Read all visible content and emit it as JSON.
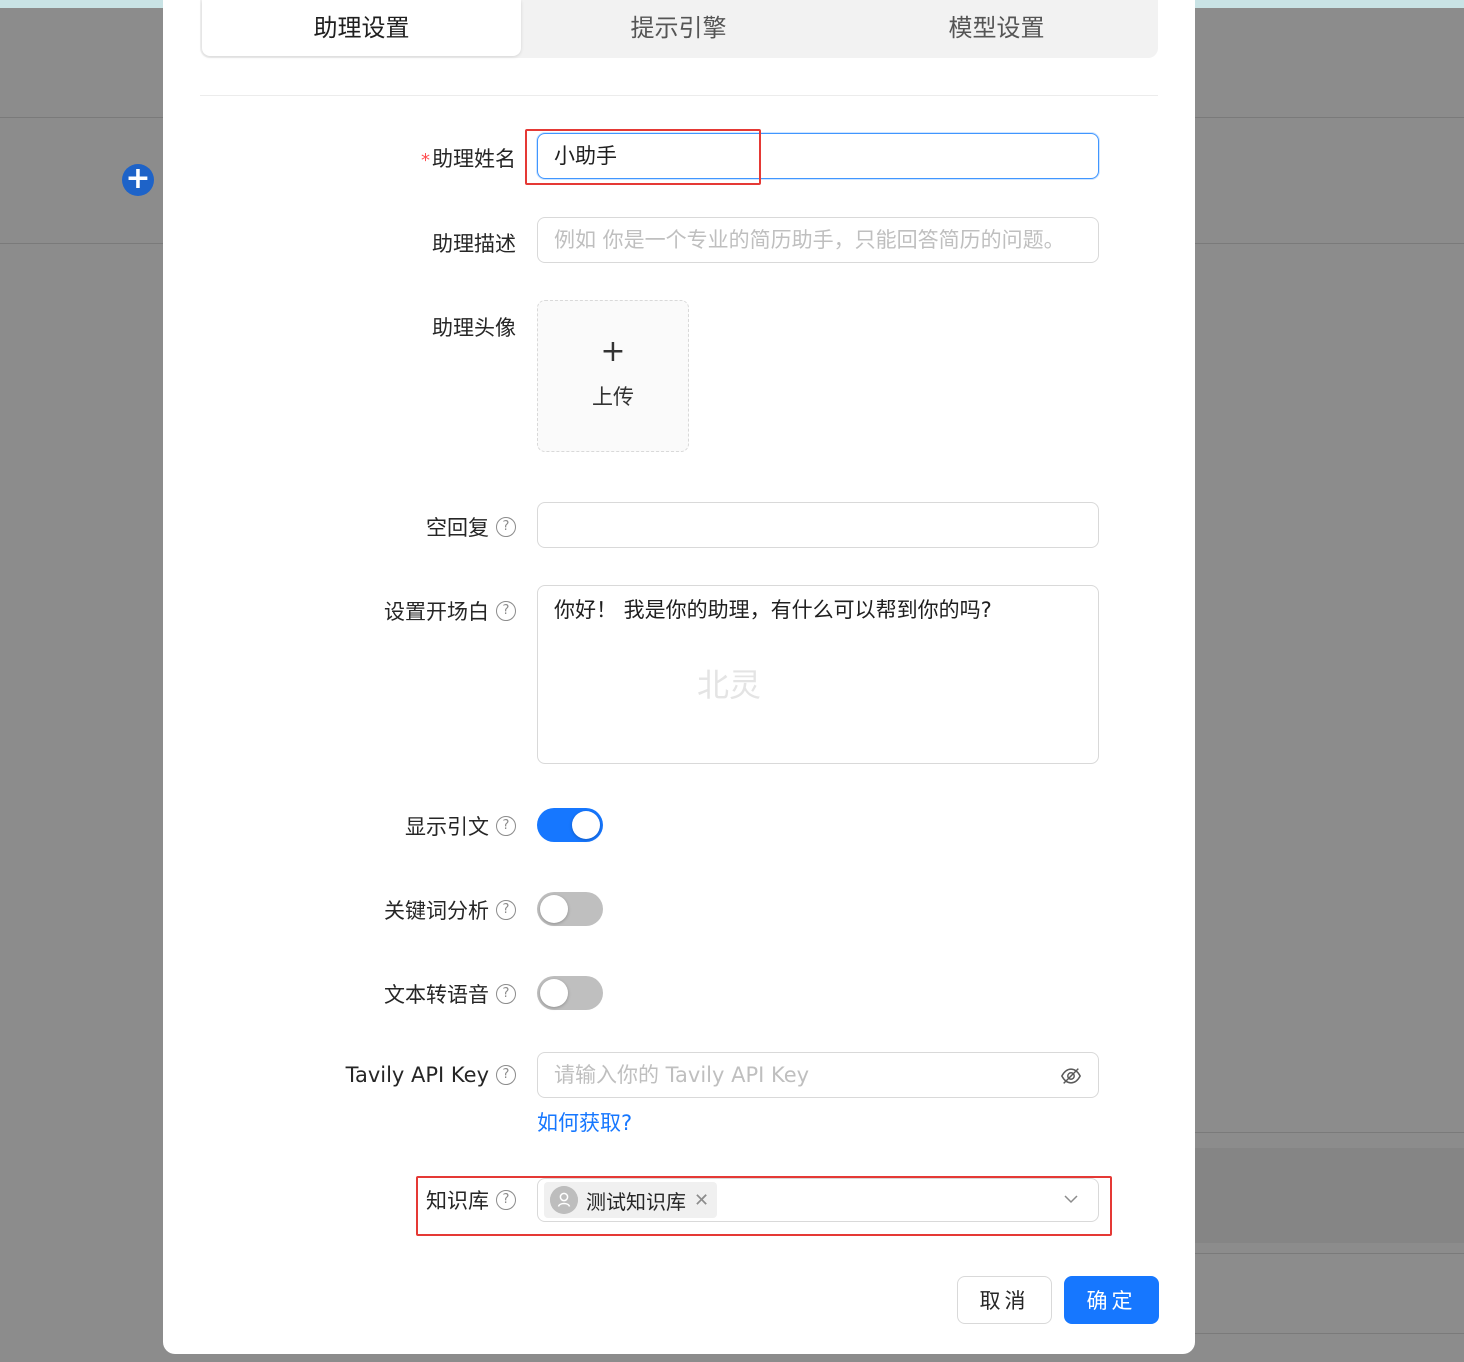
{
  "tabs": [
    {
      "label": "助理设置",
      "active": true
    },
    {
      "label": "提示引擎",
      "active": false
    },
    {
      "label": "模型设置",
      "active": false
    }
  ],
  "form": {
    "name": {
      "label": "助理姓名",
      "required_mark": "*",
      "value": "小助手"
    },
    "description": {
      "label": "助理描述",
      "placeholder": "例如 你是一个专业的简历助手，只能回答简历的问题。"
    },
    "avatar": {
      "label": "助理头像",
      "upload_plus": "+",
      "upload_label": "上传"
    },
    "empty_reply": {
      "label": "空回复",
      "value": ""
    },
    "opening": {
      "label": "设置开场白",
      "value": "你好！ 我是你的助理，有什么可以帮到你的吗?"
    },
    "show_citation": {
      "label": "显示引文",
      "on": true
    },
    "keyword_analysis": {
      "label": "关键词分析",
      "on": false
    },
    "tts": {
      "label": "文本转语音",
      "on": false
    },
    "tavily": {
      "label": "Tavily API Key",
      "placeholder": "请输入你的 Tavily API Key",
      "link": "如何获取?"
    },
    "knowledge": {
      "label": "知识库",
      "selected": [
        "测试知识库"
      ]
    }
  },
  "help_glyph": "?",
  "watermark": "北灵",
  "buttons": {
    "cancel": "取消",
    "ok": "确定"
  },
  "colors": {
    "primary": "#1677ff",
    "highlight": "#e53935",
    "required": "#ff4d4f"
  }
}
